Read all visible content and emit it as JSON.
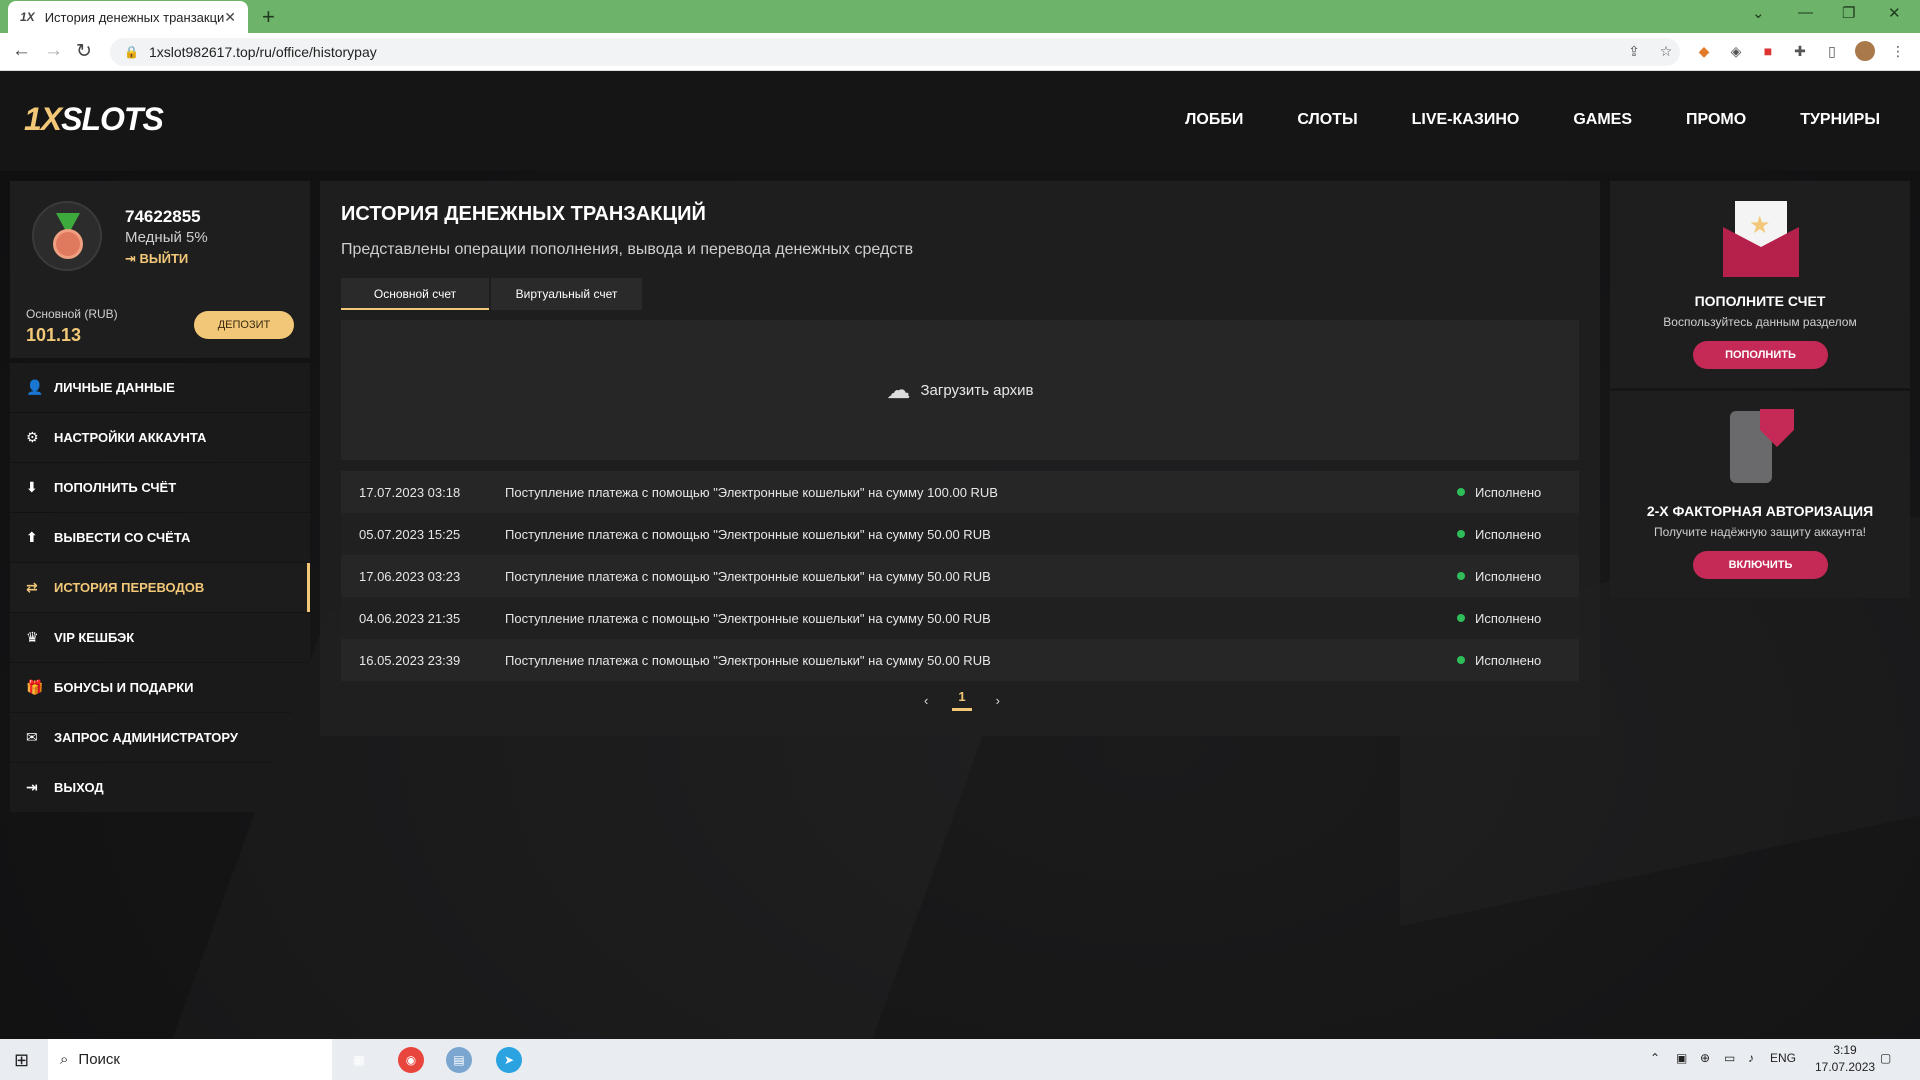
{
  "browser": {
    "tab_title": "История денежных транзакций",
    "tab_favicon": "1X",
    "url": "1xslot982617.top/ru/office/historypay"
  },
  "header": {
    "logo_prefix": "1X",
    "logo_suffix": "SLOTS",
    "nav": [
      "ЛОББИ",
      "СЛОТЫ",
      "LIVE-КАЗИНО",
      "GAMES",
      "ПРОМО",
      "ТУРНИРЫ"
    ]
  },
  "profile": {
    "user_id": "74622855",
    "level": "Медный 5%",
    "logout": "ВЫЙТИ",
    "account_label": "Основной (RUB)",
    "balance": "101.13",
    "deposit_button": "ДЕПОЗИТ"
  },
  "menu": [
    {
      "label": "ЛИЧНЫЕ ДАННЫЕ",
      "icon": "user-icon"
    },
    {
      "label": "НАСТРОЙКИ АККАУНТА",
      "icon": "gear-icon"
    },
    {
      "label": "ПОПОЛНИТЬ СЧЁТ",
      "icon": "download-icon"
    },
    {
      "label": "ВЫВЕСТИ СО СЧЁТА",
      "icon": "upload-icon"
    },
    {
      "label": "ИСТОРИЯ ПЕРЕВОДОВ",
      "icon": "transfer-icon",
      "active": true
    },
    {
      "label": "VIP КЕШБЭК",
      "icon": "crown-icon"
    },
    {
      "label": "БОНУСЫ И ПОДАРКИ",
      "icon": "gift-icon"
    },
    {
      "label": "ЗАПРОС АДМИНИСТРАТОРУ",
      "icon": "mail-icon"
    },
    {
      "label": "ВЫХОД",
      "icon": "exit-icon"
    }
  ],
  "main": {
    "title": "ИСТОРИЯ ДЕНЕЖНЫХ ТРАНЗАКЦИЙ",
    "subtitle": "Представлены операции пополнения, вывода и перевода денежных средств",
    "tabs": [
      "Основной счет",
      "Виртуальный счет"
    ],
    "archive": "Загрузить архив",
    "transactions": [
      {
        "date": "17.07.2023 03:18",
        "desc": "Поступление платежа с помощью \"Электронные кошельки\" на сумму 100.00 RUB",
        "status": "Исполнено"
      },
      {
        "date": "05.07.2023 15:25",
        "desc": "Поступление платежа с помощью \"Электронные кошельки\" на сумму 50.00 RUB",
        "status": "Исполнено"
      },
      {
        "date": "17.06.2023 03:23",
        "desc": "Поступление платежа с помощью \"Электронные кошельки\" на сумму 50.00 RUB",
        "status": "Исполнено"
      },
      {
        "date": "04.06.2023 21:35",
        "desc": "Поступление платежа с помощью \"Электронные кошельки\" на сумму 50.00 RUB",
        "status": "Исполнено"
      },
      {
        "date": "16.05.2023 23:39",
        "desc": "Поступление платежа с помощью \"Электронные кошельки\" на сумму 50.00 RUB",
        "status": "Исполнено"
      }
    ],
    "page": "1"
  },
  "cards": {
    "deposit": {
      "title": "ПОПОЛНИТЕ СЧЕТ",
      "desc": "Воспользуйтесь данным разделом",
      "button": "ПОПОЛНИТЬ"
    },
    "twofa": {
      "title": "2-Х ФАКТОРНАЯ АВТОРИЗАЦИЯ",
      "desc": "Получите надёжную защиту аккаунта!",
      "button": "ВКЛЮЧИТЬ"
    }
  },
  "taskbar": {
    "search": "Поиск",
    "lang": "ENG",
    "time": "3:19",
    "date": "17.07.2023"
  },
  "colors": {
    "accent": "#f2c878",
    "brand_pink": "#c42a55",
    "status_ok": "#2ebd59",
    "browser_frame": "#6db36a"
  }
}
